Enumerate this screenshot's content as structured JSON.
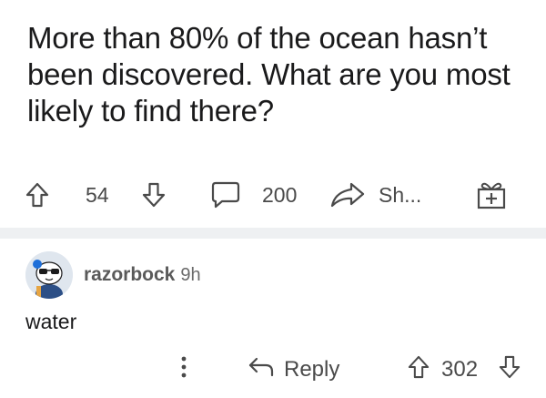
{
  "post": {
    "title": "More than 80% of the ocean hasn’t been discovered. What are you most likely to find there?",
    "upvote_icon": "arrow-up-icon",
    "score": "54",
    "downvote_icon": "arrow-down-icon",
    "comment_icon": "speech-bubble-icon",
    "comments_count": "200",
    "share_icon": "share-arrow-icon",
    "share_label": "Sh...",
    "award_icon": "gift-icon"
  },
  "comment": {
    "avatar_icon": "snoo-avatar",
    "username": "razorbock",
    "time": "9h",
    "body": "water",
    "more_icon": "vertical-ellipsis-icon",
    "reply_icon": "reply-arrow-icon",
    "reply_label": "Reply",
    "upvote_icon": "arrow-up-icon",
    "score": "302",
    "downvote_icon": "arrow-down-icon"
  },
  "colors": {
    "text": "#1a1a1b",
    "secondary": "#4a4a4a",
    "divider": "#eef0f2"
  }
}
